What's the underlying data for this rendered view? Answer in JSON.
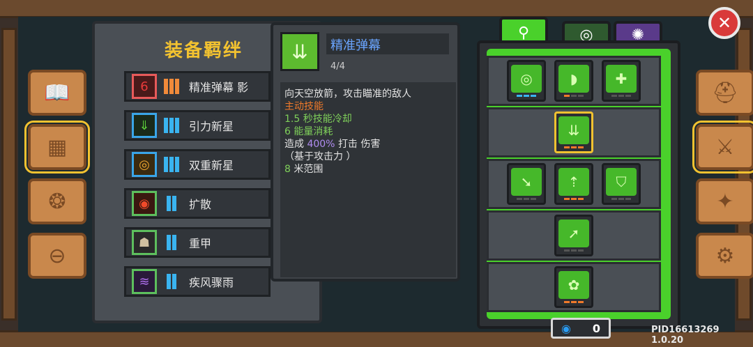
{
  "panel_title": "装备羁绊",
  "bonds": [
    {
      "name": "精准弹幕 影",
      "icon": "spiral-icon"
    },
    {
      "name": "引力新星",
      "icon": "gravity-icon"
    },
    {
      "name": "双重新星",
      "icon": "double-ring-icon"
    },
    {
      "name": "扩散",
      "icon": "spread-icon"
    },
    {
      "name": "重甲",
      "icon": "armor-icon"
    },
    {
      "name": "疾风骤雨",
      "icon": "whirlwind-icon"
    }
  ],
  "skill": {
    "name": "精准弹幕",
    "level": "4/4",
    "desc1": "向天空放箭，攻击瞄准的敌人",
    "type": "主动技能",
    "cd_val": "1.5",
    "cd_label": "秒技能冷却",
    "cost_val": "6",
    "cost_label": "能量消耗",
    "dmg_prefix": "造成",
    "dmg_val": "400%",
    "dmg_suffix": "打击 伤害",
    "dmg_note": "（基于攻击力 ）",
    "range_val": "8",
    "range_label": "米范围"
  },
  "currency": {
    "value": "0",
    "icon": "gem-icon"
  },
  "pid_text": "PID16613269 1.0.20",
  "close_icon": "close-icon"
}
